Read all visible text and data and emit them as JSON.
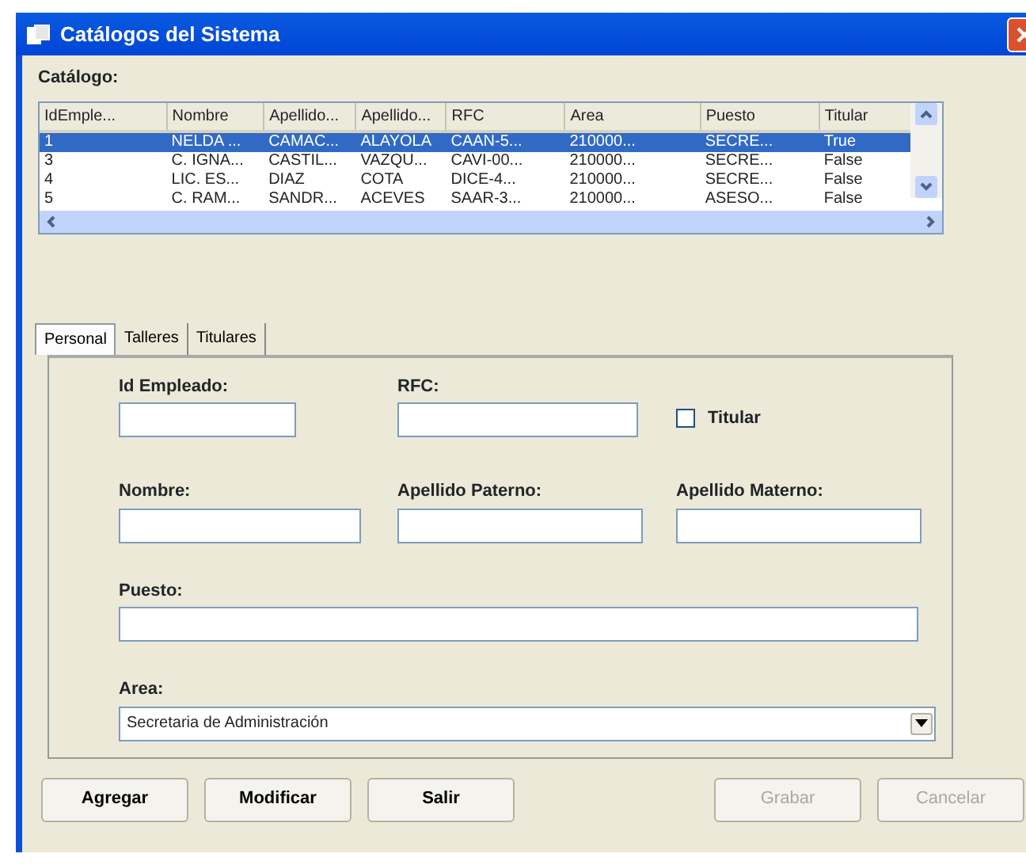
{
  "window": {
    "title": "Catálogos del Sistema"
  },
  "catalog": {
    "label": "Catálogo:",
    "columns": [
      "IdEmple...",
      "Nombre",
      "Apellido...",
      "Apellido...",
      "RFC",
      "Area",
      "Puesto",
      "Titular"
    ],
    "rows": [
      {
        "cells": [
          "1",
          "NELDA ...",
          "CAMAC...",
          "ALAYOLA",
          "CAAN-5...",
          "210000...",
          "SECRE...",
          "True"
        ],
        "selected": true
      },
      {
        "cells": [
          "3",
          "C. IGNA...",
          "CASTIL...",
          "VAZQU...",
          "CAVI-00...",
          "210000...",
          "SECRE...",
          "False"
        ],
        "selected": false
      },
      {
        "cells": [
          "4",
          "LIC. ES...",
          "DIAZ",
          "COTA",
          "DICE-4...",
          "210000...",
          "SECRE...",
          "False"
        ],
        "selected": false
      },
      {
        "cells": [
          "5",
          "C. RAM...",
          "SANDR...",
          "ACEVES",
          "SAAR-3...",
          "210000...",
          "ASESO...",
          "False"
        ],
        "selected": false
      }
    ]
  },
  "tabs": [
    {
      "label": "Personal",
      "selected": true
    },
    {
      "label": "Talleres",
      "selected": false
    },
    {
      "label": "Titulares",
      "selected": false
    }
  ],
  "form": {
    "id_label": "Id Empleado:",
    "rfc_label": "RFC:",
    "titular": {
      "label": "Titular",
      "checked": false
    },
    "nombre_label": "Nombre:",
    "paterno_label": "Apellido Paterno:",
    "materno_label": "Apellido Materno:",
    "puesto_label": "Puesto:",
    "area_label": "Area:",
    "area_value": "Secretaria de Administración"
  },
  "buttons": [
    {
      "label": "Agregar",
      "disabled": false
    },
    {
      "label": "Modificar",
      "disabled": false
    },
    {
      "label": "Salir",
      "disabled": false
    },
    {
      "label": "Grabar",
      "disabled": true
    },
    {
      "label": "Cancelar",
      "disabled": true
    }
  ]
}
